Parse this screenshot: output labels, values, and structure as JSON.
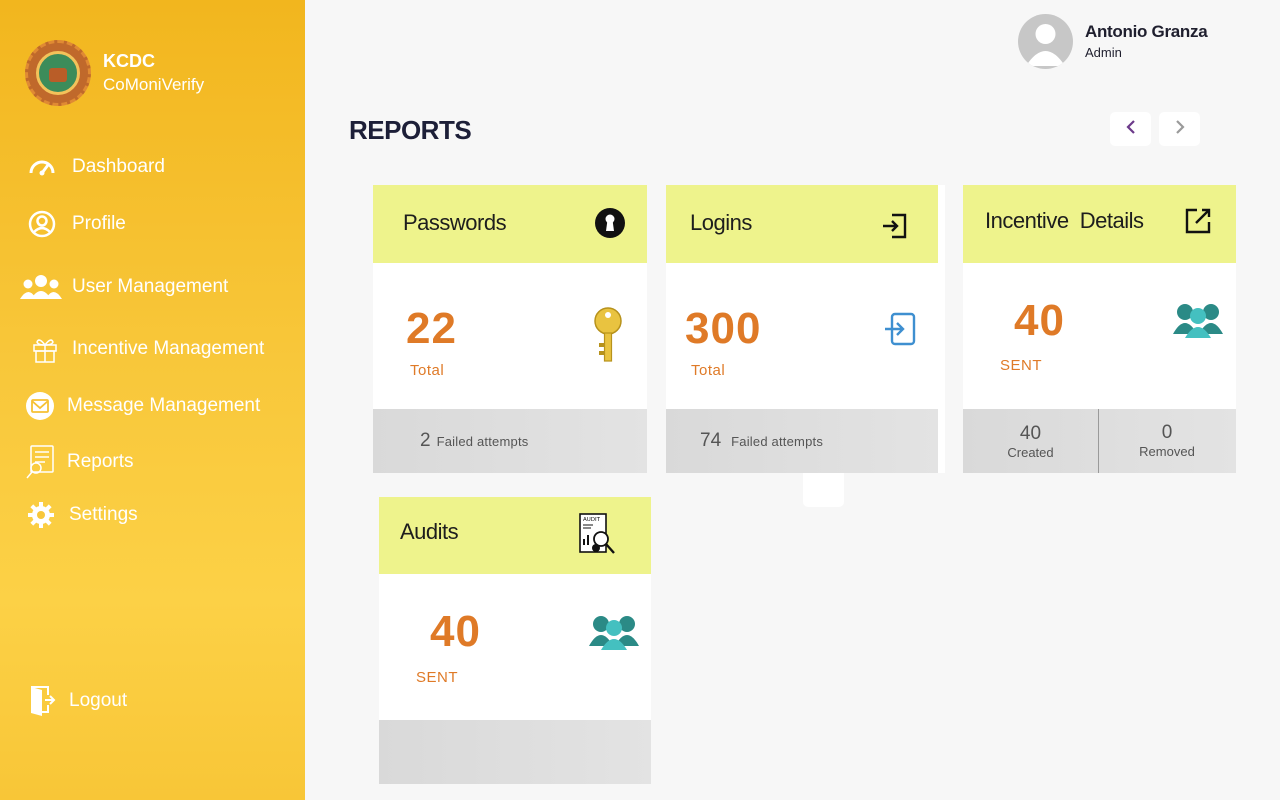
{
  "brand": {
    "name": "KCDC",
    "subtitle": "CoMoniVerify"
  },
  "sidebar": {
    "items": [
      {
        "label": "Dashboard",
        "icon": "speedometer-icon"
      },
      {
        "label": "Profile",
        "icon": "user-circle-icon"
      },
      {
        "label": "User Management",
        "icon": "users-icon"
      },
      {
        "label": "Incentive Management",
        "icon": "gift-icon"
      },
      {
        "label": "Message Management",
        "icon": "envelope-icon"
      },
      {
        "label": "Reports",
        "icon": "report-icon"
      },
      {
        "label": "Settings",
        "icon": "gear-icon"
      }
    ],
    "logout": {
      "label": "Logout",
      "icon": "logout-icon"
    }
  },
  "user": {
    "name": "Antonio Granza",
    "role": "Admin"
  },
  "page": {
    "title": "REPORTS"
  },
  "cards": {
    "passwords": {
      "title": "Passwords",
      "value": "22",
      "value_label": "Total",
      "footer_value": "2",
      "footer_label": "Failed attempts"
    },
    "logins": {
      "title": "Logins",
      "value": "300",
      "value_label": "Total",
      "footer_value": "74",
      "footer_label": "Failed attempts"
    },
    "incentive": {
      "title": "Incentive  Details",
      "value": "40",
      "value_label": "SENT",
      "created_value": "40",
      "created_label": "Created",
      "removed_value": "0",
      "removed_label": "Removed"
    },
    "audits": {
      "title": "Audits",
      "value": "40",
      "value_label": "SENT",
      "icon_label": "AUDIT"
    }
  },
  "colors": {
    "accent": "#df7a27",
    "card_header": "#eef38c",
    "sidebar": "#f8c637"
  }
}
